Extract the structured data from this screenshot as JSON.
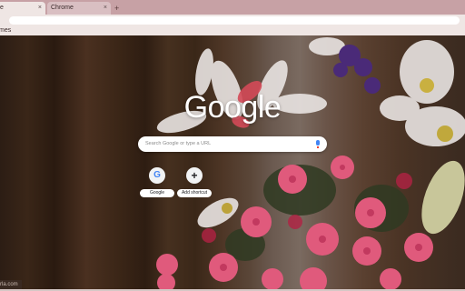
{
  "tabs": [
    {
      "title": "te",
      "close": "×"
    },
    {
      "title": "Chrome",
      "close": "×"
    }
  ],
  "new_tab": "+",
  "bookmarks": [
    "mes"
  ],
  "google_logo": "Google",
  "search": {
    "placeholder": "Search Google or type a URL"
  },
  "shortcuts": [
    {
      "label": "Google",
      "icon": "G"
    },
    {
      "label": "Add shortcut",
      "icon": "+"
    }
  ],
  "status_bar": "rla.com",
  "colors": {
    "tab_strip": "#c7a1a5",
    "toolbar": "#efe6e4",
    "accent_blue": "#4285f4",
    "flower_pink": "#e05a7c"
  }
}
